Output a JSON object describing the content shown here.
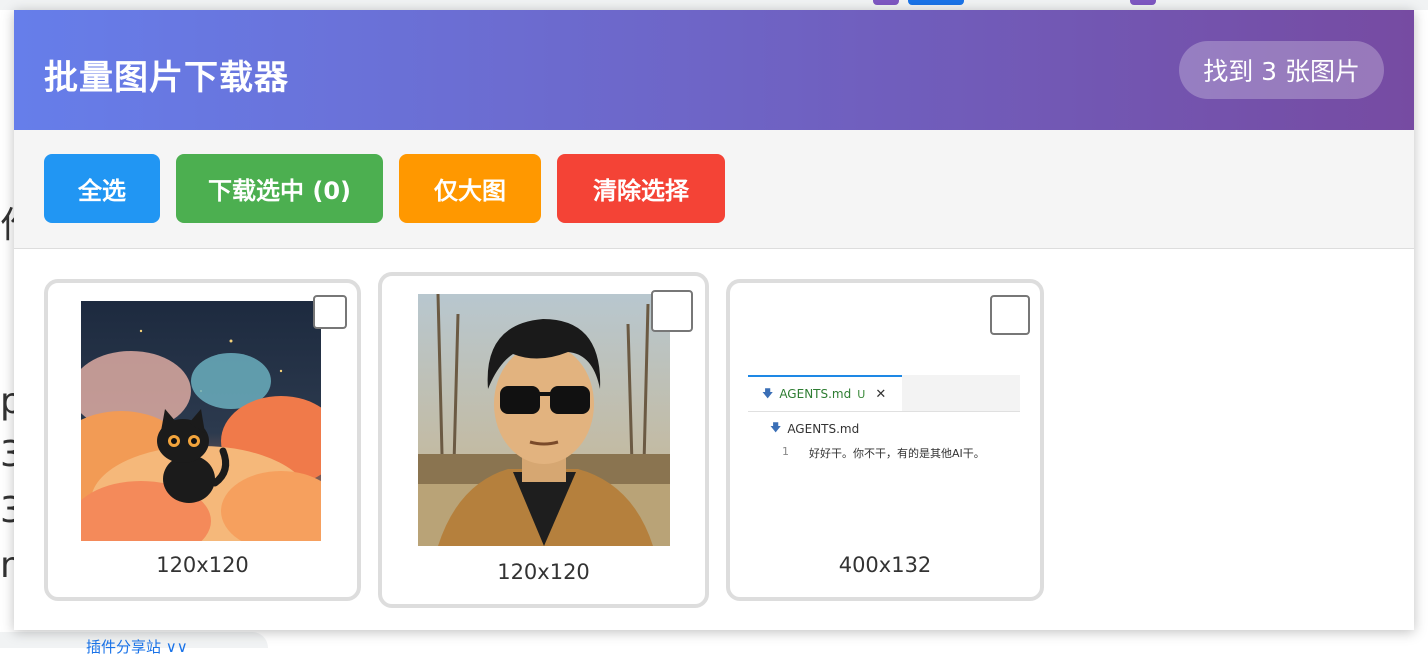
{
  "panel": {
    "title": "批量图片下载器",
    "count_label": "找到 3 张图片"
  },
  "toolbar": {
    "select_all": "全选",
    "download_selected": "下载选中 (0)",
    "large_only": "仅大图",
    "clear_selection": "清除选择"
  },
  "images": [
    {
      "dimensions": "120x120",
      "description": "black cat on colorful clouds",
      "checked": false
    },
    {
      "dimensions": "120x120",
      "description": "man with sunglasses illustration",
      "checked": false
    },
    {
      "dimensions": "400x132",
      "description": "editor screenshot",
      "checked": false
    }
  ],
  "thumbnail_editor": {
    "tab_name": "AGENTS.md",
    "tab_status": "U",
    "breadcrumb": "AGENTS.md",
    "line_number": "1",
    "line_text": "好好干。你不干，有的是其他AI干。"
  },
  "background": {
    "letters": [
      "作",
      "p",
      "3",
      "3",
      "m"
    ],
    "bottom_text": "插件分享站 ∨∨"
  },
  "colors": {
    "header_start": "#667eea",
    "header_end": "#764ba2",
    "select_all": "#2196F3",
    "download": "#4CAF50",
    "large_only": "#FF9800",
    "clear": "#f44336"
  }
}
